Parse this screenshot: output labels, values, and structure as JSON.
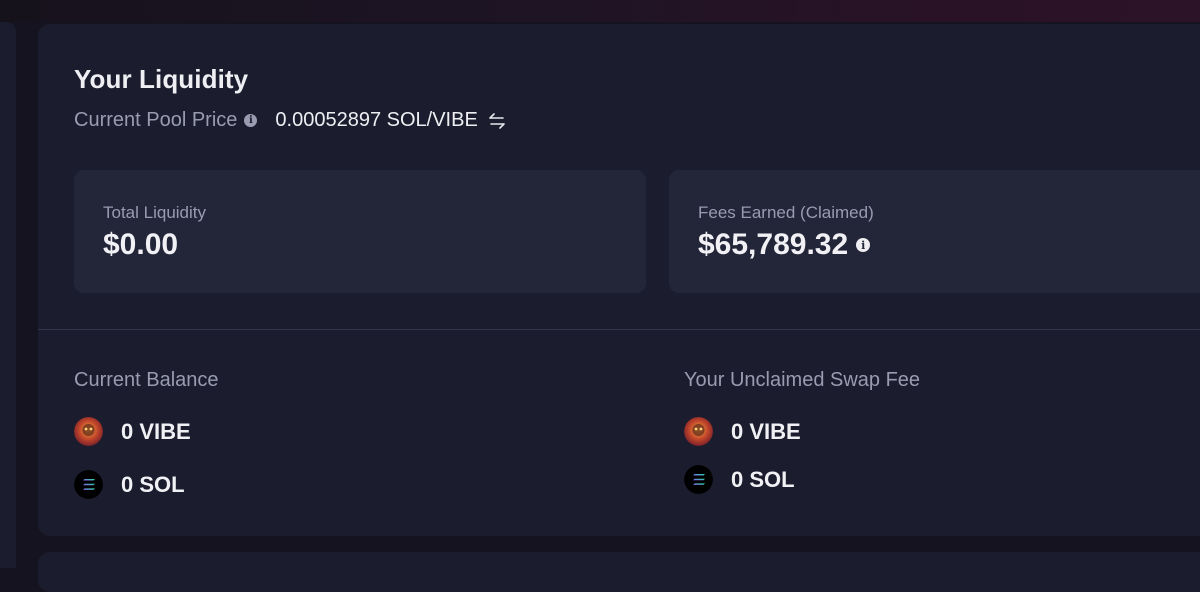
{
  "liquidity": {
    "title": "Your Liquidity",
    "price_label": "Current Pool Price",
    "price_value": "0.00052897 SOL/VIBE"
  },
  "stats": {
    "total_liquidity_label": "Total Liquidity",
    "total_liquidity_value": "$0.00",
    "fees_label": "Fees Earned (Claimed)",
    "fees_value": "$65,789.32"
  },
  "balance": {
    "title": "Current Balance",
    "tokens": [
      {
        "amount": "0 VIBE",
        "icon": "vibe-token-icon"
      },
      {
        "amount": "0 SOL",
        "icon": "sol-token-icon"
      }
    ]
  },
  "unclaimed": {
    "title": "Your Unclaimed Swap Fee",
    "tokens": [
      {
        "amount": "0 VIBE",
        "icon": "vibe-token-icon"
      },
      {
        "amount": "0 SOL",
        "icon": "sol-token-icon"
      }
    ]
  },
  "colors": {
    "background": "#14131f",
    "card": "#1b1d2e",
    "stat_box": "#232639",
    "muted_text": "#9a9bb0",
    "primary_text": "#f1f1f5"
  }
}
